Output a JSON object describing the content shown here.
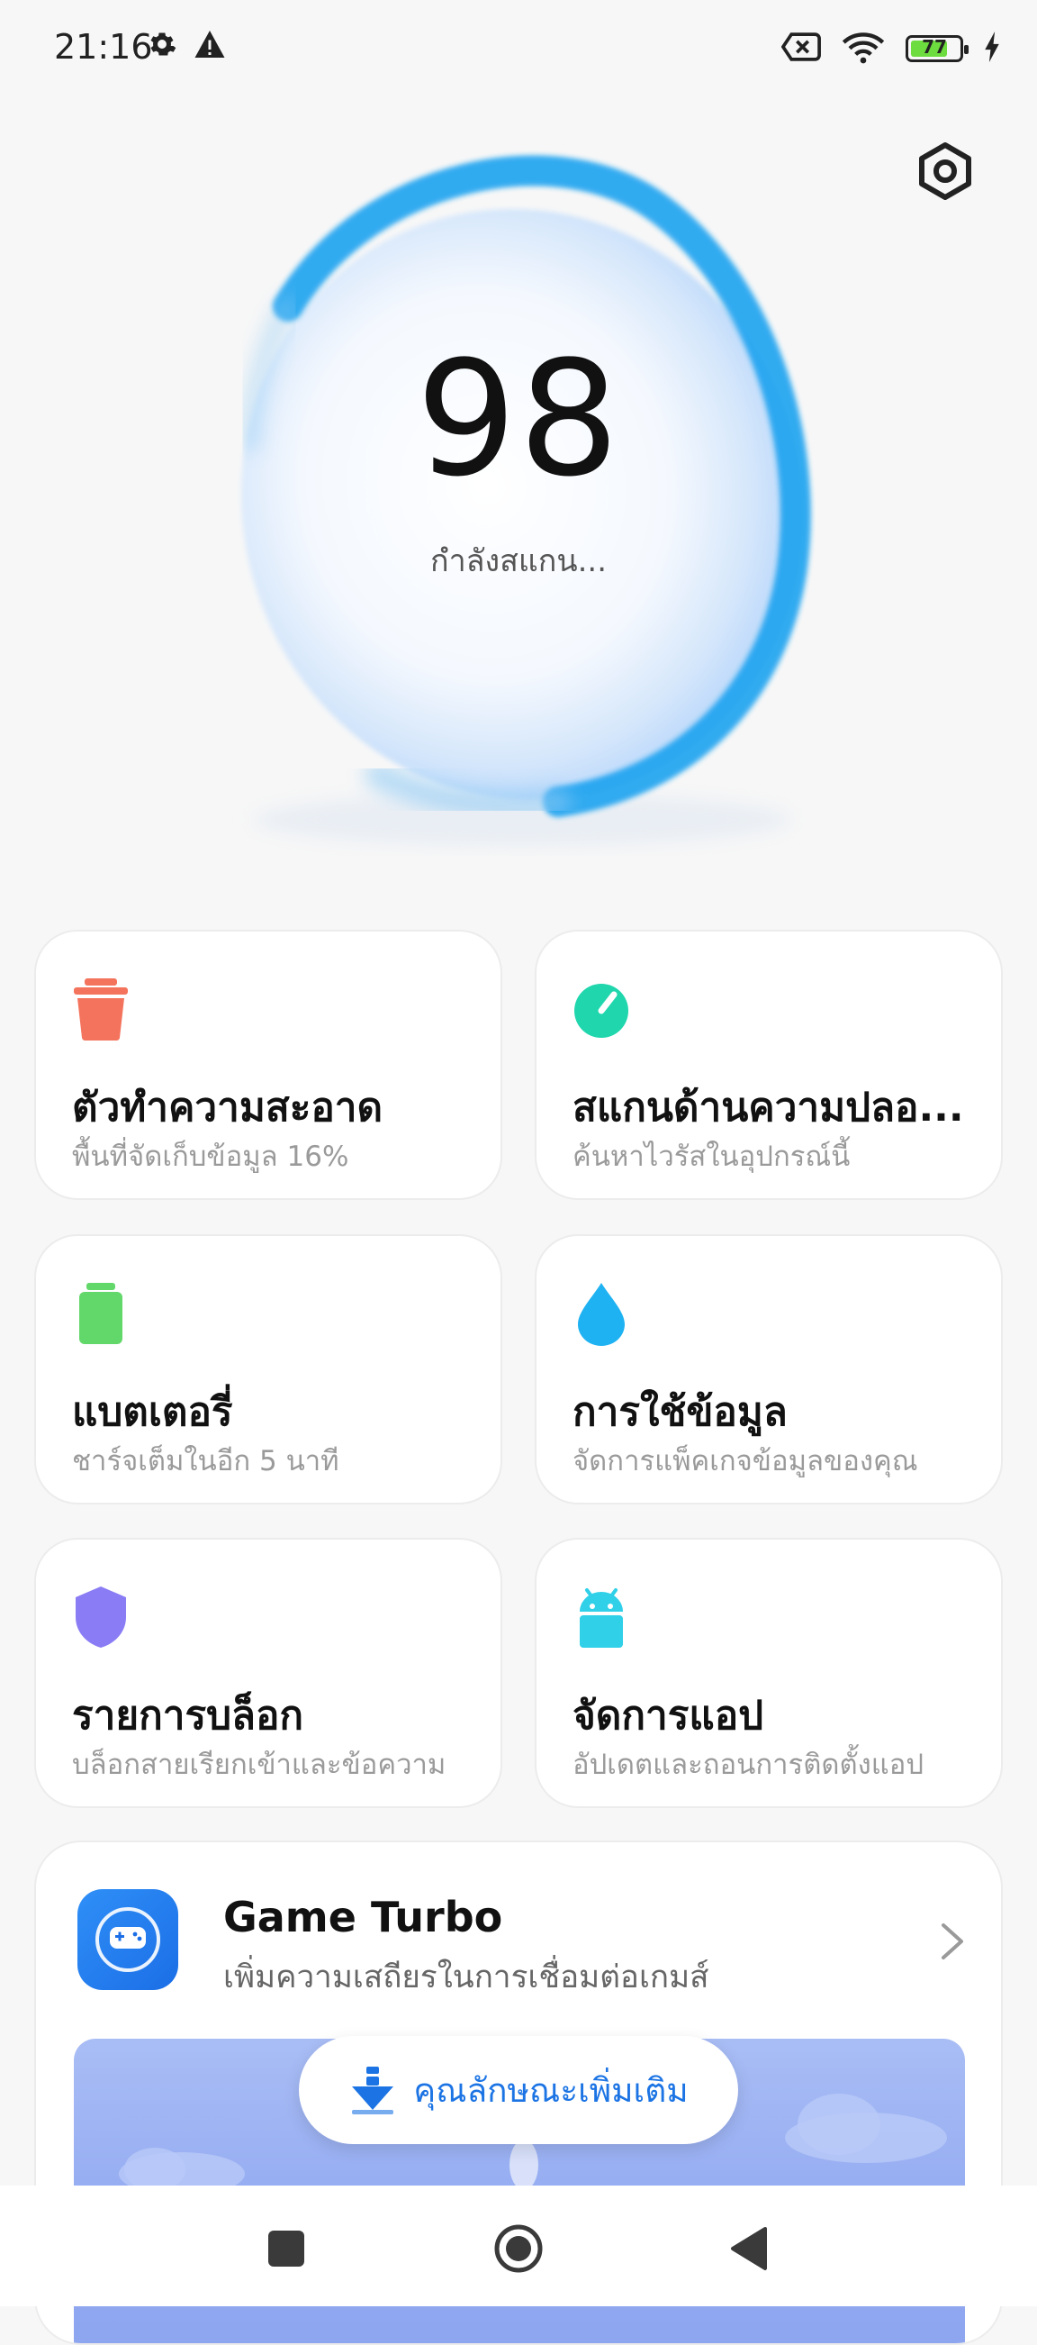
{
  "status_bar": {
    "time": "21:16",
    "battery_level": "77",
    "battery_fraction": 0.77,
    "icons": [
      "gear-icon",
      "warning-icon",
      "sim-off-icon",
      "wifi-icon",
      "battery-icon",
      "charging-icon"
    ]
  },
  "hero": {
    "score": "98",
    "status": "กำลังสแกน..."
  },
  "cards": [
    {
      "title": "ตัวทำความสะอาด",
      "subtitle": "พื้นที่จัดเก็บข้อมูล 16%",
      "icon": "trash-icon",
      "color": "#f4735c"
    },
    {
      "title": "สแกนด้านความปลอ...",
      "subtitle": "ค้นหาไวรัสในอุปกรณ์นี้",
      "icon": "gauge-icon",
      "color": "#1fd6ad"
    },
    {
      "title": "แบตเตอรี่",
      "subtitle": "ชาร์จเต็มในอีก 5 นาที",
      "icon": "battery-icon",
      "color": "#63d86a"
    },
    {
      "title": "การใช้ข้อมูล",
      "subtitle": "จัดการแพ็คเกจข้อมูลของคุณ",
      "icon": "droplet-icon",
      "color": "#1fb2f2"
    },
    {
      "title": "รายการบล็อก",
      "subtitle": "บล็อกสายเรียกเข้าและข้อความ",
      "icon": "shield-icon",
      "color": "#8a7cf4"
    },
    {
      "title": "จัดการแอป",
      "subtitle": "อัปเดตและถอนการติดตั้งแอป",
      "icon": "android-icon",
      "color": "#2fd0e8"
    }
  ],
  "game_turbo": {
    "title": "Game Turbo",
    "subtitle": "เพิ่มความเสถียรในการเชื่อมต่อเกมส์",
    "more_label": "คุณลักษณะเพิ่มเติม"
  },
  "nav": {
    "icons": [
      "recents-icon",
      "home-icon",
      "back-icon"
    ]
  }
}
